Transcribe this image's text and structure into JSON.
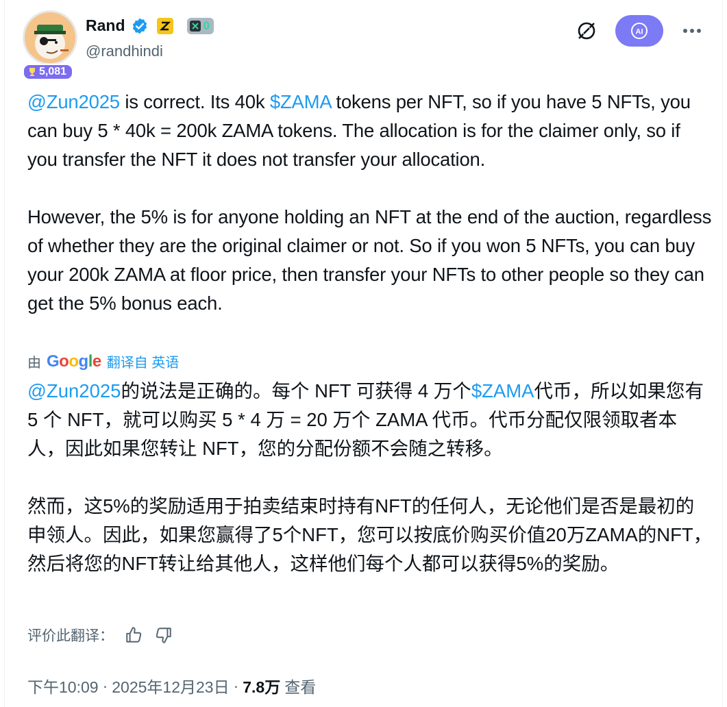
{
  "author": {
    "name": "Rand",
    "handle": "@randhindi",
    "score": "5,081",
    "x_count": "0"
  },
  "post": {
    "en_p1_mention": "@Zun2025",
    "en_p1_a": " is correct. Its 40k ",
    "en_p1_ticker": "$ZAMA",
    "en_p1_b": " tokens per NFT, so if you have 5 NFTs, you can buy 5 * 40k = 200k ZAMA tokens. The allocation is for the claimer only, so if you transfer the NFT it does not transfer your allocation.",
    "en_p2": "However, the 5% is for anyone holding an NFT at the end of the auction, regardless of whether they are the original claimer or not. So if you won 5 NFTs, you can buy your 200k ZAMA at floor price, then transfer your NFTs to other people so they can get the 5% bonus each."
  },
  "translation": {
    "by": "由",
    "google": [
      "G",
      "o",
      "o",
      "g",
      "l",
      "e"
    ],
    "link": "翻译自 英语",
    "zh_p1_mention": "@Zun2025",
    "zh_p1_a": "的说法是正确的。每个 NFT 可获得 4 万个",
    "zh_p1_ticker": "$ZAMA",
    "zh_p1_b": "代币，所以如果您有 5 个 NFT，就可以购买 5 * 4 万 = 20 万个 ZAMA 代币。代币分配仅限领取者本人，因此如果您转让 NFT，您的分配份额不会随之转移。",
    "zh_p2": "然而，这5%的奖励适用于拍卖结束时持有NFT的任何人，无论他们是否是最初的申领人。因此，如果您赢得了5个NFT，您可以按底价购买价值20万ZAMA的NFT，然后将您的NFT转让给其他人，这样他们每个人都可以获得5%的奖励。",
    "rate_label": "评价此翻译："
  },
  "meta": {
    "time": "下午10:09",
    "sep1": "·",
    "date": "2025年12月23日",
    "sep2": "·",
    "views": "7.8万",
    "views_label": "查看"
  },
  "colors": {
    "link": "#1d9bf0",
    "ai_button": "#7c7af5",
    "score_badge": "#7c6cf0"
  }
}
